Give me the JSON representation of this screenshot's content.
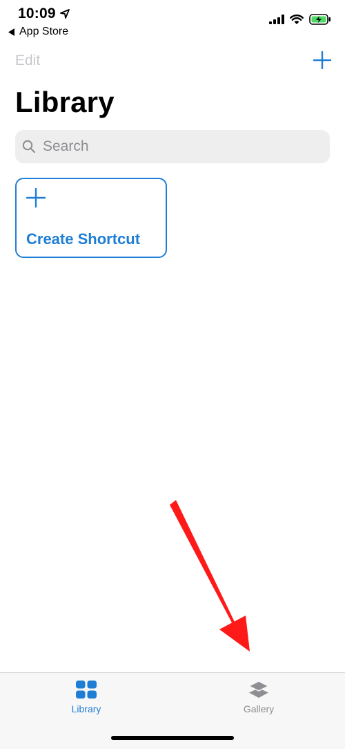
{
  "status_bar": {
    "time": "10:09",
    "back_label": "App Store"
  },
  "nav": {
    "edit_label": "Edit",
    "title": "Library"
  },
  "search": {
    "placeholder": "Search"
  },
  "create_card": {
    "label": "Create Shortcut"
  },
  "tabs": [
    {
      "label": "Library",
      "icon": "grid-icon",
      "selected": true
    },
    {
      "label": "Gallery",
      "icon": "layers-icon",
      "selected": false
    }
  ],
  "colors": {
    "accent": "#1e7ed6",
    "arrow": "#ff1a1a",
    "inactive": "#8e8e93"
  }
}
